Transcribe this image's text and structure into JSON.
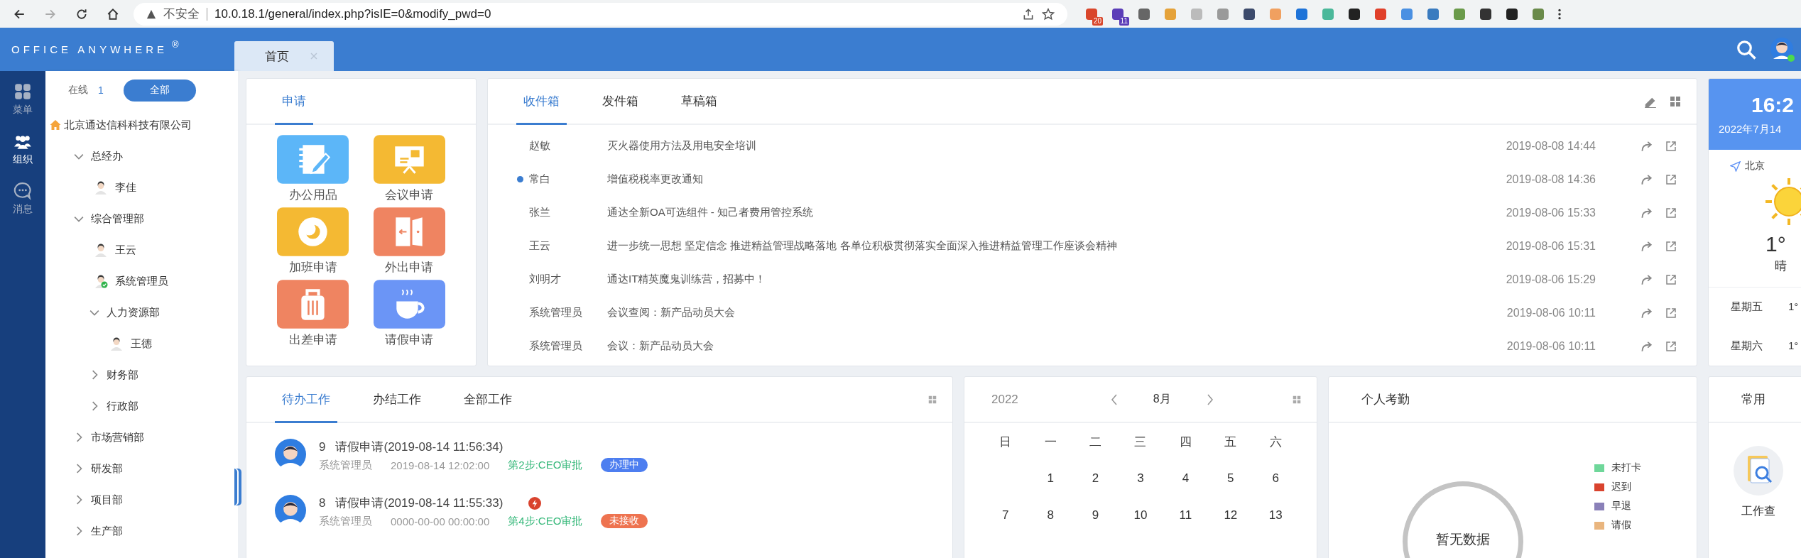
{
  "browser": {
    "security_label": "不安全",
    "url": "10.0.18.1/general/index.php?isIE=0&modify_pwd=0",
    "extensions": [
      {
        "color": "#d9462b",
        "badge": "20"
      },
      {
        "color": "#5b3db8",
        "badge": "11"
      },
      {
        "color": "#666666"
      },
      {
        "color": "#e5a23a"
      },
      {
        "color": "#bbbbbb"
      },
      {
        "color": "#9a9a9a"
      },
      {
        "color": "#3c4a6b"
      },
      {
        "color": "#f0a060"
      },
      {
        "color": "#1e73d8"
      },
      {
        "color": "#4bb89a"
      },
      {
        "color": "#222222"
      },
      {
        "color": "#e0402a"
      },
      {
        "color": "#4a90e2"
      },
      {
        "color": "#3a7bbf"
      },
      {
        "color": "#6a9a4a"
      },
      {
        "color": "#333333"
      },
      {
        "color": "#222222"
      },
      {
        "color": "#6a8a4a"
      }
    ]
  },
  "header": {
    "logo": "OFFICE ANYWHERE",
    "logo_mark": "®",
    "tabs": [
      {
        "label": "首页",
        "selected": true
      }
    ]
  },
  "nav": [
    {
      "label": "菜单",
      "selected": false
    },
    {
      "label": "组织",
      "selected": true
    },
    {
      "label": "消息",
      "selected": false
    }
  ],
  "org": {
    "online_label": "在线",
    "online_count": "1",
    "filter_button": "全部",
    "tree": {
      "label": "北京通达信科科技有限公司",
      "children": [
        {
          "kind": "dept",
          "label": "总经办",
          "expanded": true,
          "children": [
            {
              "kind": "person",
              "label": "李佳",
              "online": false
            }
          ]
        },
        {
          "kind": "dept",
          "label": "综合管理部",
          "expanded": true,
          "children": [
            {
              "kind": "person",
              "label": "王云",
              "online": false
            },
            {
              "kind": "person",
              "label": "系统管理员",
              "online": true
            },
            {
              "kind": "dept",
              "label": "人力资源部",
              "expanded": true,
              "children": [
                {
                  "kind": "person",
                  "label": "王德",
                  "online": false
                }
              ]
            },
            {
              "kind": "dept",
              "label": "财务部",
              "expanded": false
            },
            {
              "kind": "dept",
              "label": "行政部",
              "expanded": false
            }
          ]
        },
        {
          "kind": "dept",
          "label": "市场营销部",
          "expanded": false
        },
        {
          "kind": "dept",
          "label": "研发部",
          "expanded": false
        },
        {
          "kind": "dept",
          "label": "项目部",
          "expanded": false
        },
        {
          "kind": "dept",
          "label": "生产部",
          "expanded": false
        }
      ]
    }
  },
  "apply": {
    "tabs": [
      {
        "label": "申请",
        "selected": true
      }
    ],
    "items": [
      {
        "label": "办公用品",
        "color": "#5cb6f8"
      },
      {
        "label": "会议申请",
        "color": "#f4b933"
      },
      {
        "label": "加班申请",
        "color": "#f4b933"
      },
      {
        "label": "外出申请",
        "color": "#ef8461"
      },
      {
        "label": "出差申请",
        "color": "#ef8461"
      },
      {
        "label": "请假申请",
        "color": "#6b95f6"
      }
    ]
  },
  "mail": {
    "tabs": [
      {
        "label": "收件箱",
        "selected": true
      },
      {
        "label": "发件箱",
        "selected": false
      },
      {
        "label": "草稿箱",
        "selected": false
      }
    ],
    "rows": [
      {
        "sender": "赵敏",
        "subject": "灭火器使用方法及用电安全培训",
        "time": "2019-08-08 14:44",
        "unread": false
      },
      {
        "sender": "常白",
        "subject": "增值税税率更改通知",
        "time": "2019-08-08 14:36",
        "unread": true
      },
      {
        "sender": "张兰",
        "subject": "通达全新OA可选组件 - 知己者费用管控系统",
        "time": "2019-08-06 15:33",
        "unread": false
      },
      {
        "sender": "王云",
        "subject": "进一步统一思想 坚定信念 推进精益管理战略落地 各单位积极贯彻落实全面深入推进精益管理工作座谈会精神",
        "time": "2019-08-06 15:31",
        "unread": false
      },
      {
        "sender": "刘明才",
        "subject": "通达IT精英魔鬼训练营，招募中！",
        "time": "2019-08-06 15:29",
        "unread": false
      },
      {
        "sender": "系统管理员",
        "subject": "会议查阅：新产品动员大会",
        "time": "2019-08-06 10:11",
        "unread": false
      },
      {
        "sender": "系统管理员",
        "subject": "会议：新产品动员大会",
        "time": "2019-08-06 10:11",
        "unread": false
      }
    ]
  },
  "weather": {
    "time": "16:2",
    "date": "2022年7月14",
    "city": "北京",
    "temperature": "1°",
    "condition": "晴",
    "forecast": [
      {
        "day": "星期五",
        "temperature": "1°"
      },
      {
        "day": "星期六",
        "temperature": "1°"
      }
    ]
  },
  "work": {
    "tabs": [
      {
        "label": "待办工作",
        "selected": true
      },
      {
        "label": "办结工作",
        "selected": false
      },
      {
        "label": "全部工作",
        "selected": false
      }
    ],
    "items": [
      {
        "number": "9",
        "title": "请假申请(2019-08-14 11:56:34)",
        "urgent": false,
        "user": "系统管理员",
        "time": "2019-08-14 12:02:00",
        "step": "第2步:CEO审批",
        "status": "办理中",
        "kind": "processing"
      },
      {
        "number": "8",
        "title": "请假申请(2019-08-14 11:55:33)",
        "urgent": true,
        "user": "系统管理员",
        "time": "0000-00-00 00:00:00",
        "step": "第4步:CEO审批",
        "status": "未接收",
        "kind": "unreceived"
      }
    ]
  },
  "calendar": {
    "year": "2022",
    "month": "8月",
    "weekdays": [
      "日",
      "一",
      "二",
      "三",
      "四",
      "五",
      "六"
    ],
    "weeks": [
      [
        "1",
        "2",
        "3",
        "4",
        "5",
        "6"
      ],
      [
        "7",
        "8",
        "9",
        "10",
        "11",
        "12",
        "13"
      ]
    ]
  },
  "attendance": {
    "title": "个人考勤",
    "empty_text": "暂无数据",
    "legend": [
      {
        "label": "未打卡",
        "color": "#6fd79a"
      },
      {
        "label": "迟到",
        "color": "#d9432e"
      },
      {
        "label": "早退",
        "color": "#8a80b8"
      },
      {
        "label": "请假",
        "color": "#e9b57e"
      }
    ]
  },
  "common": {
    "title": "常用",
    "items": [
      {
        "label": "工作查"
      }
    ]
  }
}
